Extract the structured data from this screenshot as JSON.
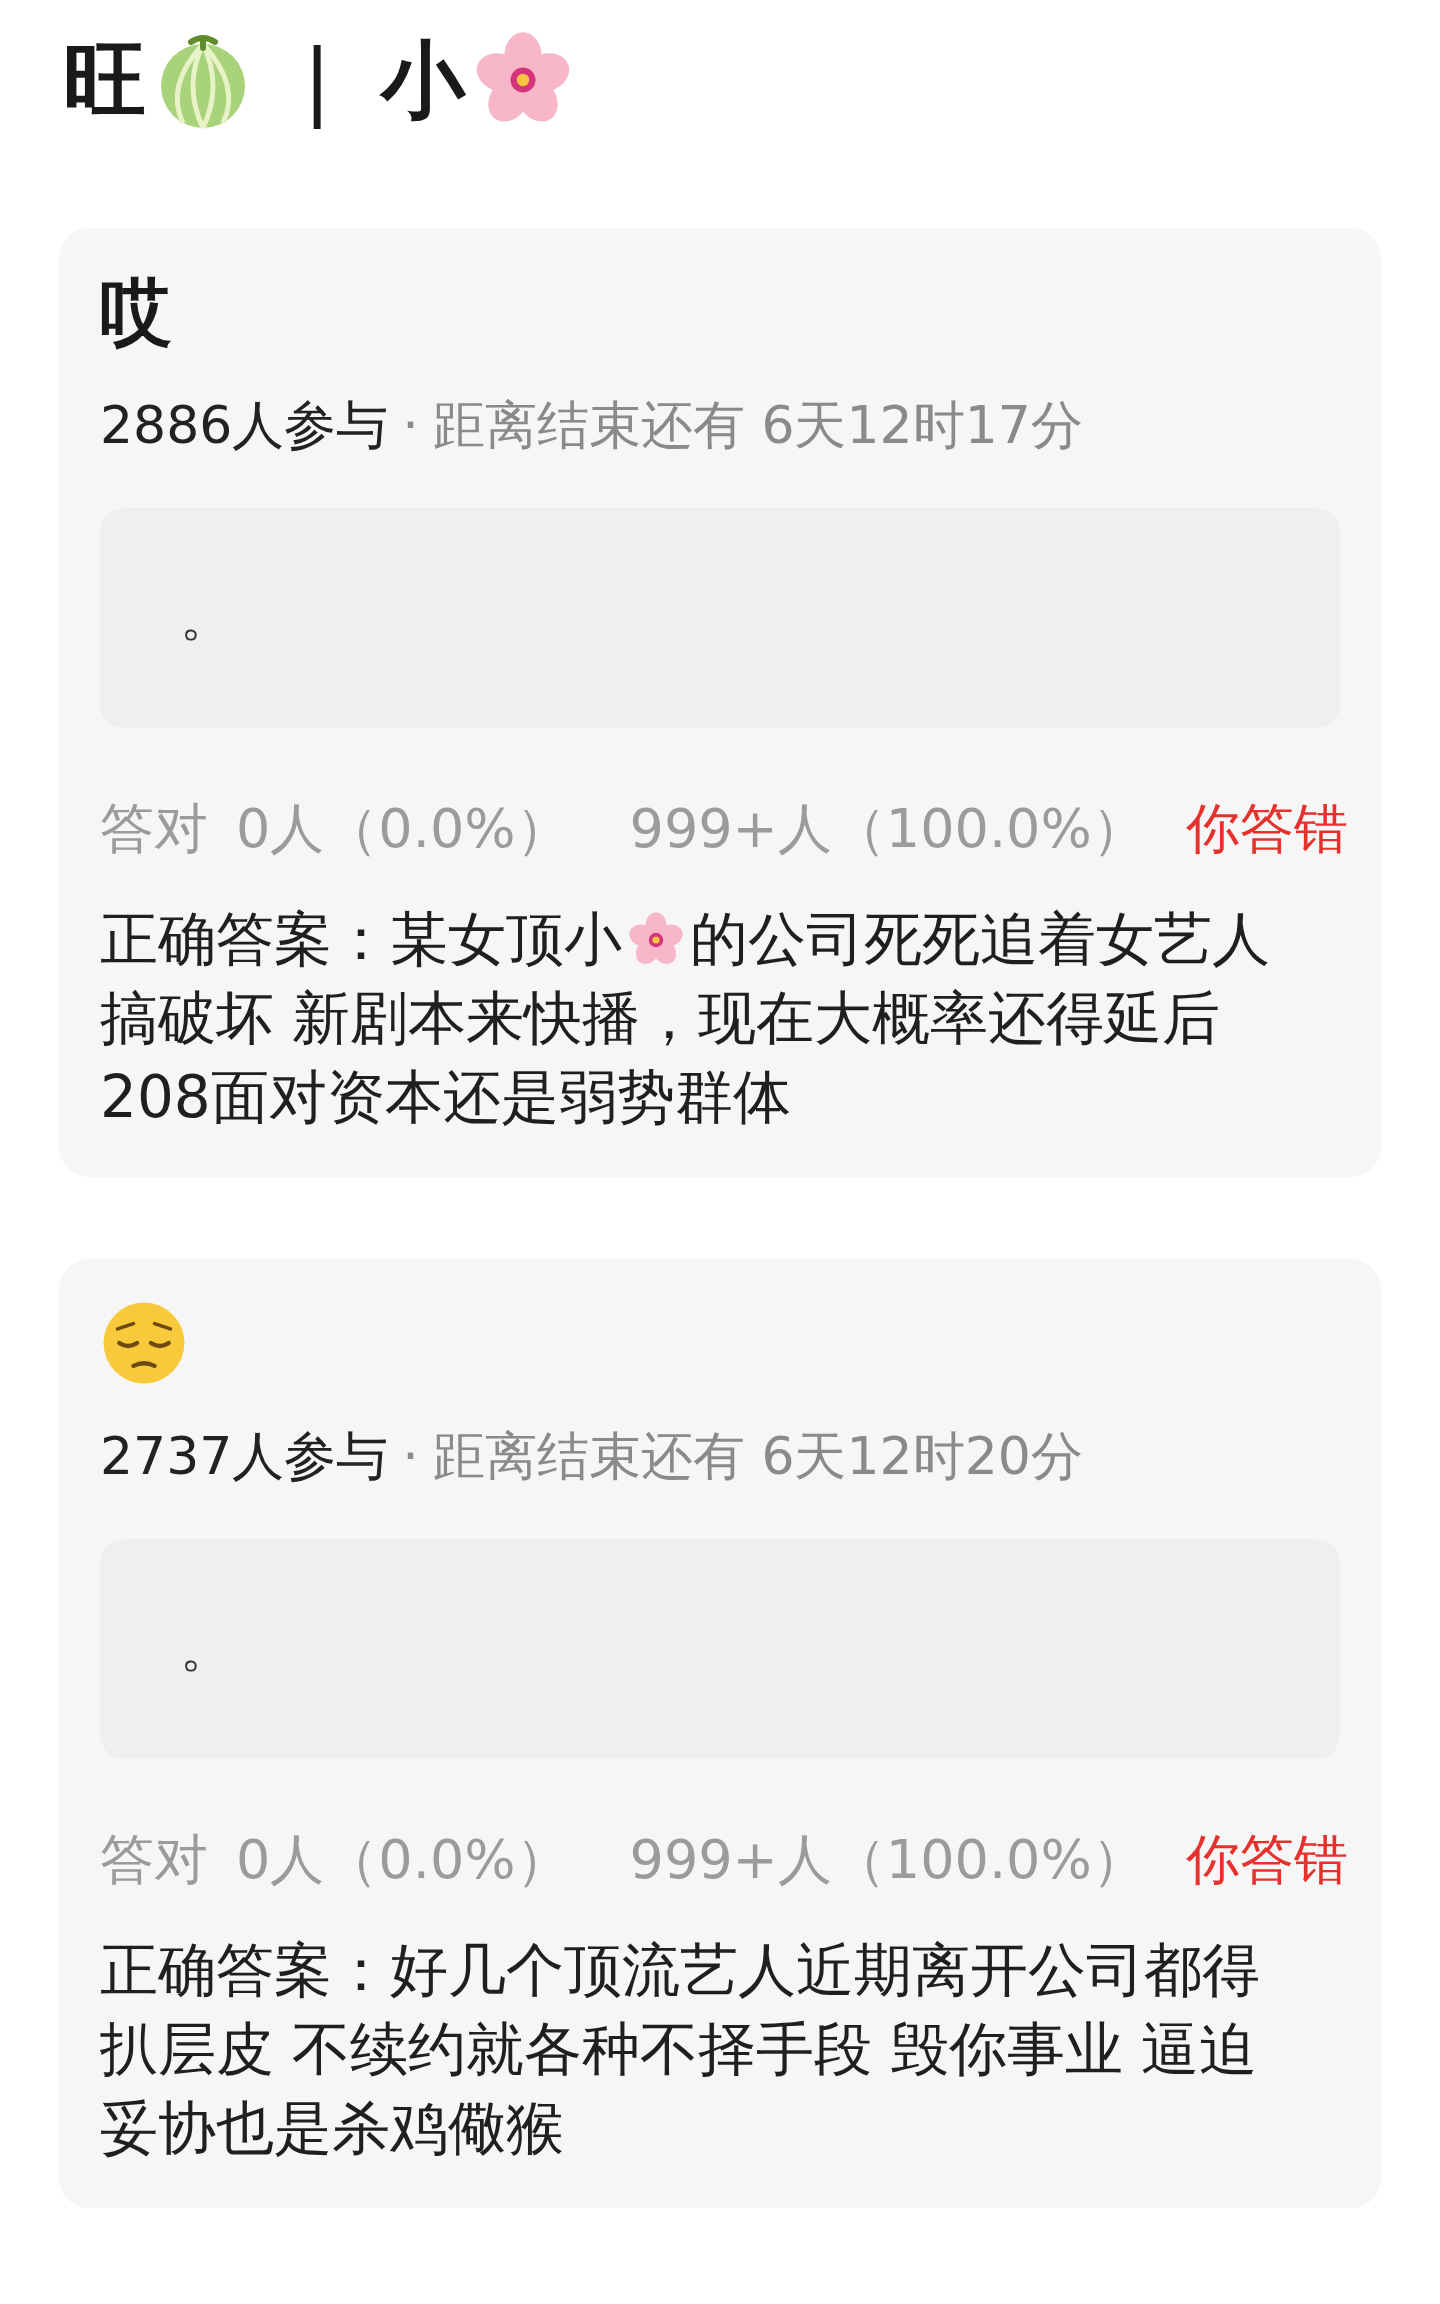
{
  "header": [
    {
      "kind": "text",
      "text": "旺"
    },
    {
      "kind": "melon"
    },
    {
      "kind": "text",
      "text": "|"
    },
    {
      "kind": "text",
      "text": "小"
    },
    {
      "kind": "blossom"
    }
  ],
  "cards": [
    {
      "title": {
        "kind": "text",
        "text": "哎"
      },
      "participants": "2886人参与",
      "separator": "·",
      "deadline": "距离结束还有 6天12时17分",
      "my_answer": "。",
      "stats": {
        "label": "答对",
        "correct": "0人（0.0%）",
        "wrong": "999+人（100.0%）",
        "result": "你答错"
      },
      "answer_lines": [
        [
          {
            "kind": "text",
            "text": "正确答案：某女顶小"
          },
          {
            "kind": "blossom"
          },
          {
            "kind": "text",
            "text": "的公司死死追着女艺人"
          }
        ],
        [
          {
            "kind": "text",
            "text": "搞破坏 新剧本来快播，现在大概率还得延后"
          }
        ],
        [
          {
            "kind": "text",
            "text": "208面对资本还是弱势群体"
          }
        ]
      ]
    },
    {
      "title": {
        "kind": "face"
      },
      "participants": "2737人参与",
      "separator": "·",
      "deadline": "距离结束还有 6天12时20分",
      "my_answer": "。",
      "stats": {
        "label": "答对",
        "correct": "0人（0.0%）",
        "wrong": "999+人（100.0%）",
        "result": "你答错"
      },
      "answer_lines": [
        [
          {
            "kind": "text",
            "text": "正确答案：好几个顶流艺人近期离开公司都得"
          }
        ],
        [
          {
            "kind": "text",
            "text": "扒层皮 不续约就各种不择手段 毁你事业 逼迫"
          }
        ],
        [
          {
            "kind": "text",
            "text": "妥协也是杀鸡儆猴"
          }
        ]
      ]
    }
  ]
}
